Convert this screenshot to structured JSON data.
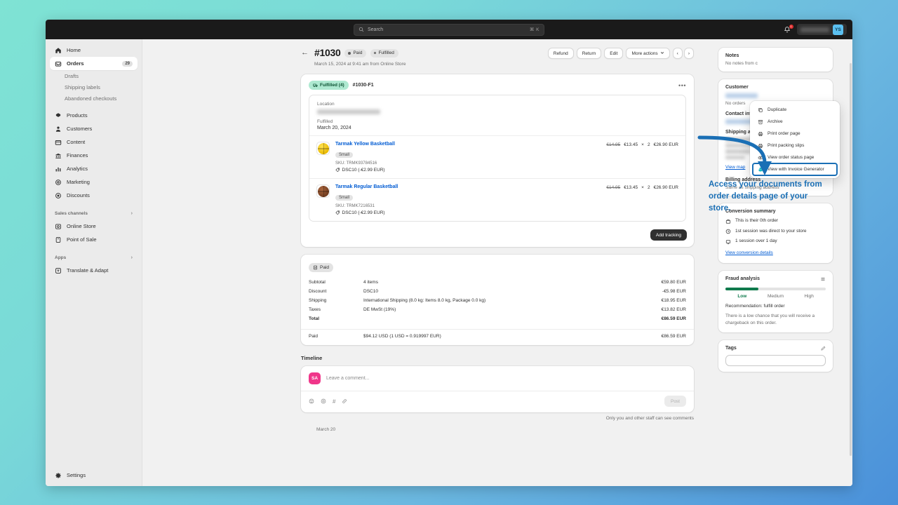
{
  "topbar": {
    "search_placeholder": "Search",
    "search_shortcut": "⌘ K",
    "notification_count": "1",
    "store_name_redacted": "Store Name",
    "avatar_initials": "YS"
  },
  "sidebar": {
    "items": [
      {
        "label": "Home",
        "icon": "home-icon",
        "badge": "",
        "active": false
      },
      {
        "label": "Orders",
        "icon": "orders-icon",
        "badge": "29",
        "active": true
      }
    ],
    "orders_sub": [
      "Drafts",
      "Shipping labels",
      "Abandoned checkouts"
    ],
    "items2": [
      {
        "label": "Products",
        "icon": "products-icon"
      },
      {
        "label": "Customers",
        "icon": "customers-icon"
      },
      {
        "label": "Content",
        "icon": "content-icon"
      },
      {
        "label": "Finances",
        "icon": "finances-icon"
      },
      {
        "label": "Analytics",
        "icon": "analytics-icon"
      },
      {
        "label": "Marketing",
        "icon": "marketing-icon"
      },
      {
        "label": "Discounts",
        "icon": "discounts-icon"
      }
    ],
    "group_sales": "Sales channels",
    "sales_channels": [
      {
        "label": "Online Store",
        "icon": "online-store-icon"
      },
      {
        "label": "Point of Sale",
        "icon": "point-of-sale-icon"
      }
    ],
    "group_apps": "Apps",
    "apps": [
      {
        "label": "Translate & Adapt",
        "icon": "translate-adapt-icon"
      }
    ],
    "settings": "Settings"
  },
  "order": {
    "number": "#1030",
    "status_paid": "Paid",
    "status_fulfilled": "Fulfilled",
    "date_line": "March 15, 2024 at 9:41 am from Online Store",
    "actions": {
      "refund": "Refund",
      "return": "Return",
      "edit": "Edit",
      "more_actions": "More actions",
      "prev": "‹",
      "next": "›"
    }
  },
  "more_actions_menu": {
    "items": [
      {
        "label": "Duplicate",
        "icon": "duplicate-icon",
        "highlighted": false
      },
      {
        "label": "Archive",
        "icon": "archive-icon",
        "highlighted": false
      },
      {
        "label": "Print order page",
        "icon": "printer-icon",
        "highlighted": false
      },
      {
        "label": "Print packing slips",
        "icon": "printer-icon",
        "highlighted": false
      },
      {
        "label": "View order status page",
        "icon": "eye-icon",
        "highlighted": false
      },
      {
        "label": "View with Invoice Generator",
        "icon": "invoice-generator-icon",
        "highlighted": true
      }
    ]
  },
  "fulfillment": {
    "badge": "Fulfilled (4)",
    "id": "#1030-F1",
    "location_label": "Location",
    "fulfilled_label": "Fulfilled",
    "fulfilled_date": "March 20, 2024",
    "add_tracking": "Add tracking",
    "items": [
      {
        "name": "Tarmak Yellow Basketball",
        "variant": "Small",
        "sku": "SKU: TRMK93784516",
        "discount": "DSC10 (-€2.99 EUR)",
        "price_original": "€14.95",
        "price": "€13.45",
        "qty_sym": "×",
        "qty": "2",
        "total": "€26.90 EUR",
        "ball_color": "yellow"
      },
      {
        "name": "Tarmak Regular Basketball",
        "variant": "Small",
        "sku": "SKU: TRMK7216531",
        "discount": "DSC10 (-€2.99 EUR)",
        "price_original": "€14.95",
        "price": "€13.45",
        "qty_sym": "×",
        "qty": "2",
        "total": "€26.90 EUR",
        "ball_color": "brown"
      }
    ]
  },
  "payment": {
    "badge": "Paid",
    "rows": [
      {
        "label": "Subtotal",
        "detail": "4 items",
        "amount": "€59.80 EUR"
      },
      {
        "label": "Discount",
        "detail": "DSC10",
        "amount": "-€5.98 EUR"
      },
      {
        "label": "Shipping",
        "detail": "International Shipping (8.0 kg: Items 8.0 kg, Package 0.0 kg)",
        "amount": "€18.95 EUR"
      },
      {
        "label": "Taxes",
        "detail": "DE MwSt (19%)",
        "amount": "€13.82 EUR"
      },
      {
        "label": "Total",
        "detail": "",
        "amount": "€86.59 EUR"
      }
    ],
    "paid_row": {
      "label": "Paid",
      "detail": "$94.12 USD (1 USD = 0.919997 EUR)",
      "amount": "€86.59 EUR"
    }
  },
  "timeline": {
    "title": "Timeline",
    "avatar_initials": "SA",
    "placeholder": "Leave a comment...",
    "post_label": "Post",
    "privacy_note": "Only you and other staff can see comments",
    "date_marker": "March 20"
  },
  "rail": {
    "notes": {
      "title": "Notes",
      "body": "No notes from c"
    },
    "customer": {
      "title": "Customer",
      "orders": "No orders",
      "contact_title": "Contact information",
      "shipping_title": "Shipping address",
      "view_map": "View map",
      "billing_title": "Billing address",
      "billing_value": "Same as shipping address"
    },
    "conversion": {
      "title": "Conversion summary",
      "lines": [
        {
          "text": "This is their 0th order",
          "icon": "order-icon"
        },
        {
          "text": "1st session was direct to your store",
          "icon": "clock-icon"
        },
        {
          "text": "1 session over 1 day",
          "icon": "monitor-icon"
        }
      ],
      "link": "View conversion details"
    },
    "fraud": {
      "title": "Fraud analysis",
      "levels": [
        "Low",
        "Medium",
        "High"
      ],
      "recommendation": "Recommendation: fulfill order",
      "body": "There is a low chance that you will receive a chargeback on this order."
    },
    "tags": {
      "title": "Tags"
    }
  },
  "annotation": {
    "text": "Access your documents from order details page of your store.",
    "color": "#1a6fb5"
  }
}
